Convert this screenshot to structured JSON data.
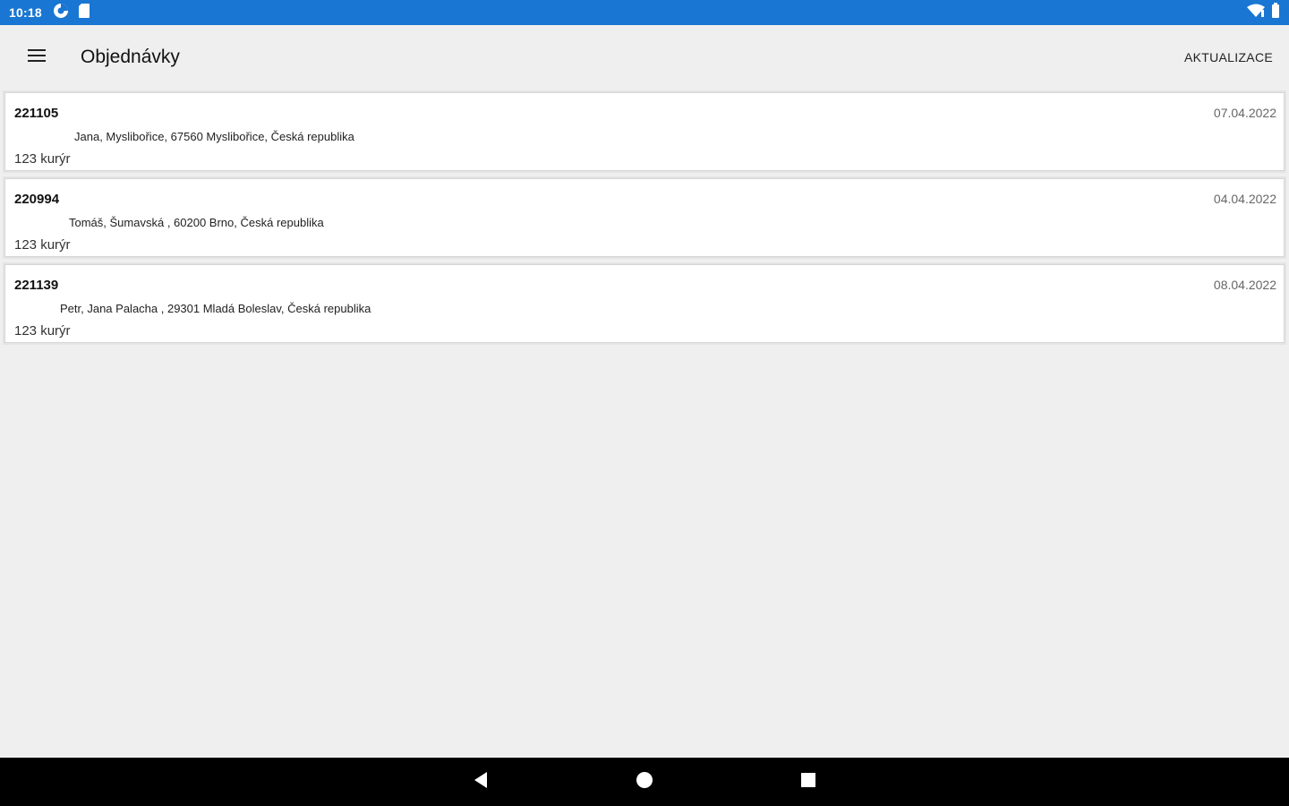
{
  "status_bar": {
    "time": "10:18",
    "icons_left": [
      "data-saver-icon",
      "sim-card-icon"
    ],
    "icons_right": [
      "wifi-icon",
      "battery-icon"
    ]
  },
  "toolbar": {
    "title": "Objednávky",
    "refresh_label": "AKTUALIZACE"
  },
  "orders": [
    {
      "number": "221105",
      "date": "07.04.2022",
      "address": "Jana, Myslibořice, 67560 Myslibořice, Česká republika",
      "courier": "123 kurýr"
    },
    {
      "number": "220994",
      "date": "04.04.2022",
      "address": "Tomáš, Šumavská , 60200 Brno, Česká republika",
      "courier": "123 kurýr"
    },
    {
      "number": "221139",
      "date": "08.04.2022",
      "address": "Petr, Jana Palacha , 29301 Mladá Boleslav, Česká republika",
      "courier": "123 kurýr"
    }
  ],
  "colors": {
    "status_bar": "#1976d2",
    "background": "#efefef",
    "card": "#ffffff",
    "nav_bar": "#000000"
  }
}
